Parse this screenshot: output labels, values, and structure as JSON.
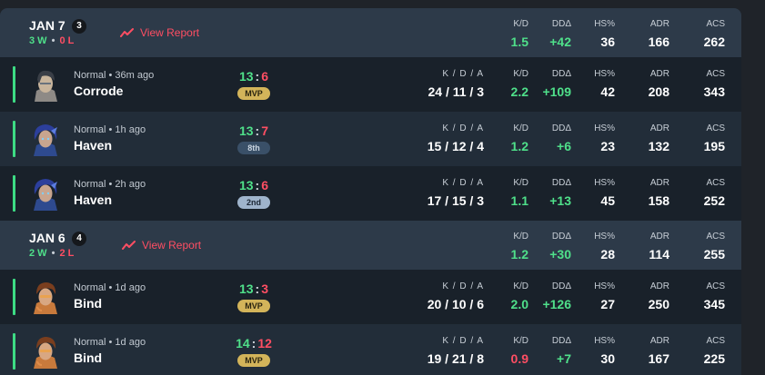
{
  "days": [
    {
      "date": "JAN 7",
      "count": "3",
      "wins": "3",
      "losses": "0",
      "view_report": "View Report",
      "stats": {
        "kd": {
          "label": "K/D",
          "value": "1.5"
        },
        "dd": {
          "label": "DDΔ",
          "value": "+42"
        },
        "hs": {
          "label": "HS%",
          "value": "36"
        },
        "adr": {
          "label": "ADR",
          "value": "166"
        },
        "acs": {
          "label": "ACS",
          "value": "262"
        }
      },
      "matches": [
        {
          "mode": "Normal • 36m ago",
          "map": "Corrode",
          "score_us": "13",
          "score_them": "6",
          "badge": "MVP",
          "kda_label": "K / D / A",
          "kda": "24 / 11 / 3",
          "kd_label": "K/D",
          "kd": "2.2",
          "dd_label": "DDΔ",
          "dd": "+109",
          "hs_label": "HS%",
          "hs": "42",
          "adr_label": "ADR",
          "adr": "208",
          "acs_label": "ACS",
          "acs": "343"
        },
        {
          "mode": "Normal • 1h ago",
          "map": "Haven",
          "score_us": "13",
          "score_them": "7",
          "badge": "8th",
          "kda_label": "K / D / A",
          "kda": "15 / 12 / 4",
          "kd_label": "K/D",
          "kd": "1.2",
          "dd_label": "DDΔ",
          "dd": "+6",
          "hs_label": "HS%",
          "hs": "23",
          "adr_label": "ADR",
          "adr": "132",
          "acs_label": "ACS",
          "acs": "195"
        },
        {
          "mode": "Normal • 2h ago",
          "map": "Haven",
          "score_us": "13",
          "score_them": "6",
          "badge": "2nd",
          "kda_label": "K / D / A",
          "kda": "17 / 15 / 3",
          "kd_label": "K/D",
          "kd": "1.1",
          "dd_label": "DDΔ",
          "dd": "+13",
          "hs_label": "HS%",
          "hs": "45",
          "adr_label": "ADR",
          "adr": "158",
          "acs_label": "ACS",
          "acs": "252"
        }
      ]
    },
    {
      "date": "JAN 6",
      "count": "4",
      "wins": "2",
      "losses": "2",
      "view_report": "View Report",
      "stats": {
        "kd": {
          "label": "K/D",
          "value": "1.2"
        },
        "dd": {
          "label": "DDΔ",
          "value": "+30"
        },
        "hs": {
          "label": "HS%",
          "value": "28"
        },
        "adr": {
          "label": "ADR",
          "value": "114"
        },
        "acs": {
          "label": "ACS",
          "value": "255"
        }
      },
      "matches": [
        {
          "mode": "Normal • 1d ago",
          "map": "Bind",
          "score_us": "13",
          "score_them": "3",
          "badge": "MVP",
          "kda_label": "K / D / A",
          "kda": "20 / 10 / 6",
          "kd_label": "K/D",
          "kd": "2.0",
          "dd_label": "DDΔ",
          "dd": "+126",
          "hs_label": "HS%",
          "hs": "27",
          "adr_label": "ADR",
          "adr": "250",
          "acs_label": "ACS",
          "acs": "345"
        },
        {
          "mode": "Normal • 1d ago",
          "map": "Bind",
          "score_us": "14",
          "score_them": "12",
          "badge": "MVP",
          "kda_label": "K / D / A",
          "kda": "19 / 21 / 8",
          "kd_label": "K/D",
          "kd": "0.9",
          "dd_label": "DDΔ",
          "dd": "+7",
          "hs_label": "HS%",
          "hs": "30",
          "adr_label": "ADR",
          "adr": "167",
          "acs_label": "ACS",
          "acs": "225"
        }
      ]
    }
  ],
  "icons": {
    "view_report": "trend-up-icon",
    "agent_a": "agent-portrait-icon",
    "agent_b": "agent-portrait-icon",
    "agent_c": "agent-portrait-icon"
  },
  "colors": {
    "win": "#4fe08a",
    "loss": "#ff4e63",
    "header_bg": "#2d3a49",
    "row_bg_dark": "#19212a",
    "row_bg_light": "#222d39",
    "mvp": "#d3b45a"
  }
}
